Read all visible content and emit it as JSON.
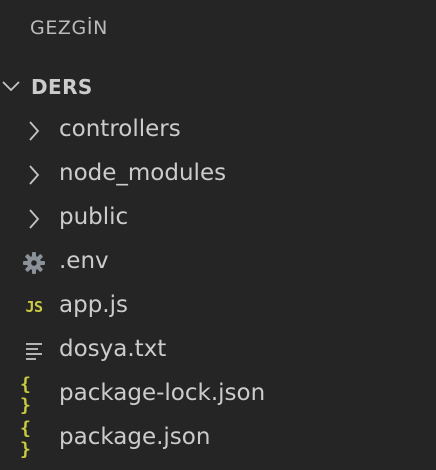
{
  "explorer": {
    "title": "GEZGİN"
  },
  "workspace": {
    "name": "DERS",
    "expanded": true
  },
  "tree": {
    "folders": [
      {
        "label": "controllers",
        "icon": "chevron-right-icon"
      },
      {
        "label": "node_modules",
        "icon": "chevron-right-icon"
      },
      {
        "label": "public",
        "icon": "chevron-right-icon"
      }
    ],
    "files": [
      {
        "label": ".env",
        "icon": "gear-icon"
      },
      {
        "label": "app.js",
        "icon": "js-file-icon",
        "icon_text": "JS"
      },
      {
        "label": "dosya.txt",
        "icon": "text-lines-icon"
      },
      {
        "label": "package-lock.json",
        "icon": "json-braces-icon",
        "icon_text": "{ }"
      },
      {
        "label": "package.json",
        "icon": "json-braces-icon",
        "icon_text": "{ }"
      }
    ]
  },
  "colors": {
    "background": "#252526",
    "text": "#cccccc",
    "icon_gray": "#c5c5c5",
    "gear": "#8a9199",
    "js_yellow": "#cbcb41",
    "json_yellow": "#cbcb41"
  }
}
